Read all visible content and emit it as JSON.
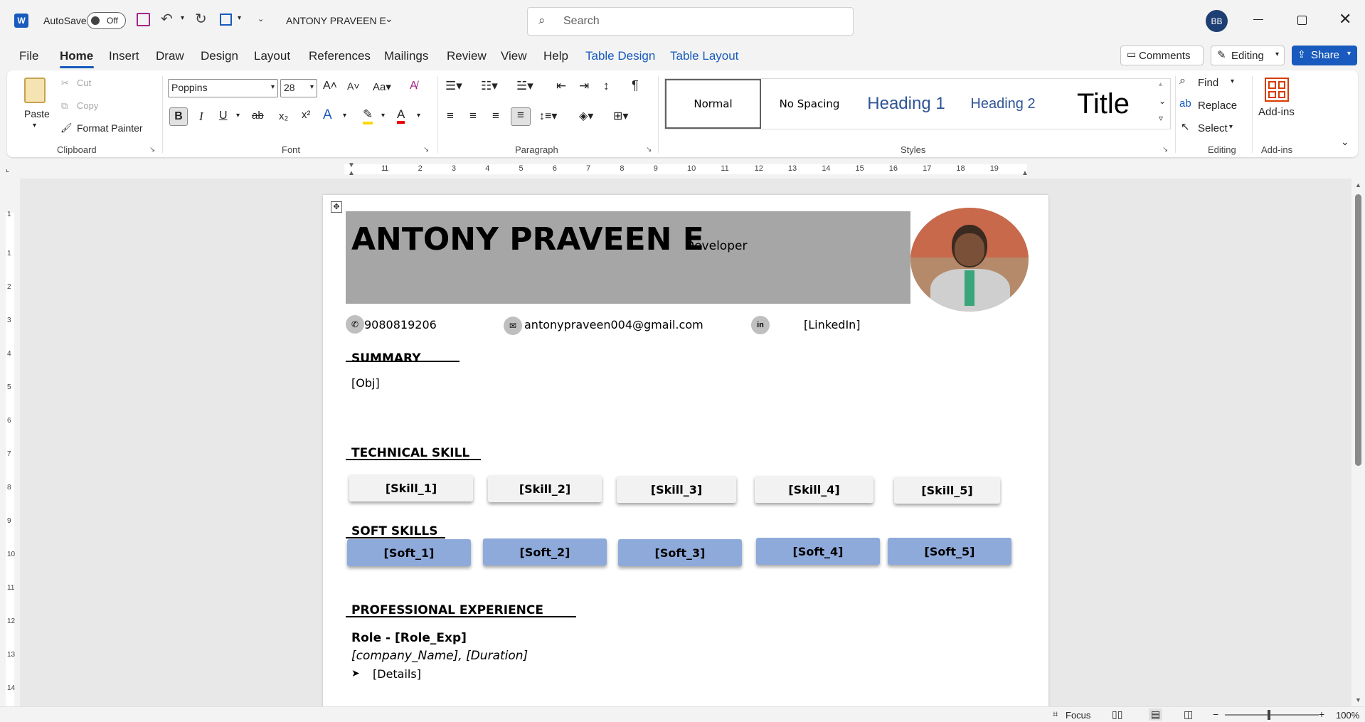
{
  "titlebar": {
    "autosave_label": "AutoSave",
    "autosave_state": "Off",
    "doc_title": "ANTONY PRAVEEN E",
    "search_placeholder": "Search",
    "user_initials": "BB"
  },
  "tabs": [
    "File",
    "Home",
    "Insert",
    "Draw",
    "Design",
    "Layout",
    "References",
    "Mailings",
    "Review",
    "View",
    "Help",
    "Table Design",
    "Table Layout"
  ],
  "tab_right": {
    "comments": "Comments",
    "editing": "Editing",
    "share": "Share"
  },
  "clipboard": {
    "paste": "Paste",
    "cut": "Cut",
    "copy": "Copy",
    "format_painter": "Format Painter",
    "label": "Clipboard"
  },
  "font": {
    "name": "Poppins",
    "size": "28",
    "label": "Font"
  },
  "paragraph": {
    "label": "Paragraph"
  },
  "styles": {
    "items": [
      "Normal",
      "No Spacing",
      "Heading 1",
      "Heading 2",
      "Title"
    ],
    "label": "Styles"
  },
  "editing": {
    "find": "Find",
    "replace": "Replace",
    "select": "Select",
    "label": "Editing"
  },
  "addins": {
    "button": "Add-ins",
    "label": "Add-ins"
  },
  "ruler": {
    "h_numbers": [
      "1",
      "1",
      "2",
      "3",
      "4",
      "5",
      "6",
      "7",
      "8",
      "9",
      "10",
      "11",
      "12",
      "13",
      "14",
      "15",
      "16",
      "17",
      "18",
      "19"
    ],
    "v_numbers": [
      "1",
      "1",
      "2",
      "3",
      "4",
      "5",
      "6",
      "7",
      "8",
      "9",
      "10",
      "11",
      "12",
      "13",
      "14"
    ]
  },
  "resume": {
    "name": "ANTONY PRAVEEN E",
    "title": "Developer",
    "phone": "9080819206",
    "email": "antonypraveen004@gmail.com",
    "linkedin": "[LinkedIn]",
    "summary_heading": "SUMMARY",
    "summary_text": "[Obj]",
    "tech_heading": "TECHNICAL SKILL",
    "skills": [
      "[Skill_1]",
      "[Skill_2]",
      "[Skill_3]",
      "[Skill_4]",
      "[Skill_5]"
    ],
    "soft_heading": "SOFT SKILLS",
    "soft": [
      "[Soft_1]",
      "[Soft_2]",
      "[Soft_3]",
      "[Soft_4]",
      "[Soft_5]"
    ],
    "exp_heading": "PROFESSIONAL EXPERIENCE",
    "role": "Role - [Role_Exp]",
    "company": "[company_Name], [Duration]",
    "details": "[Details]"
  },
  "status": {
    "focus": "Focus",
    "zoom": "100%"
  },
  "colors": {
    "accent": "#185abd",
    "header_band": "#a6a6a6",
    "soft_chip": "#8eaadb",
    "skill_chip": "#f2f2f2"
  }
}
